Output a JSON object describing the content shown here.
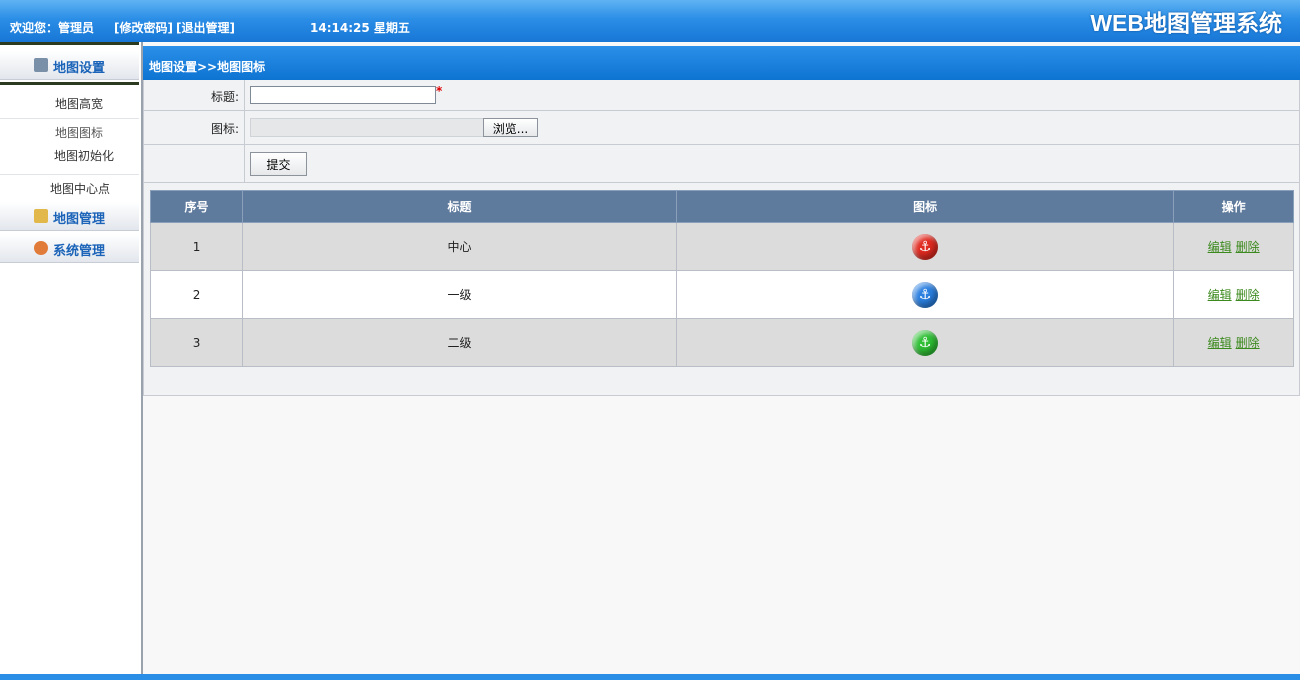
{
  "header": {
    "welcome": "欢迎您：管理员",
    "change_password": "[修改密码]",
    "logout": "[退出管理]",
    "clock": "14:14:25 星期五",
    "system_title": "WEB地图管理系统"
  },
  "sidebar": {
    "sections": [
      {
        "label": "地图设置",
        "icon": "map-settings-icon"
      },
      {
        "label": "地图管理",
        "icon": "map-manage-icon"
      },
      {
        "label": "系统管理",
        "icon": "user-admin-icon"
      }
    ],
    "items": [
      {
        "label": "地图高宽"
      },
      {
        "label": "地图图标"
      },
      {
        "label": "地图初始化"
      },
      {
        "label": "地图中心点"
      }
    ]
  },
  "breadcrumb": "地图设置>>地图图标",
  "form": {
    "title_label": "标题:",
    "title_value": "",
    "required_mark": "*",
    "icon_label": "图标:",
    "browse_button": "浏览...",
    "submit_button": "提交"
  },
  "table": {
    "columns": [
      "序号",
      "标题",
      "图标",
      "操作"
    ],
    "rows": [
      {
        "index": "1",
        "title": "中心",
        "icon_color": "#e02a20",
        "icon": "anchor-icon"
      },
      {
        "index": "2",
        "title": "一级",
        "icon_color": "#2a7fe0",
        "icon": "anchor-icon"
      },
      {
        "index": "3",
        "title": "二级",
        "icon_color": "#2fbf35",
        "icon": "anchor-icon"
      }
    ],
    "edit_label": "编辑",
    "delete_label": "删除"
  },
  "colors": {
    "header_blue": "#1877d6",
    "table_header": "#5e7a9c",
    "link_green": "#3c8a1e"
  }
}
